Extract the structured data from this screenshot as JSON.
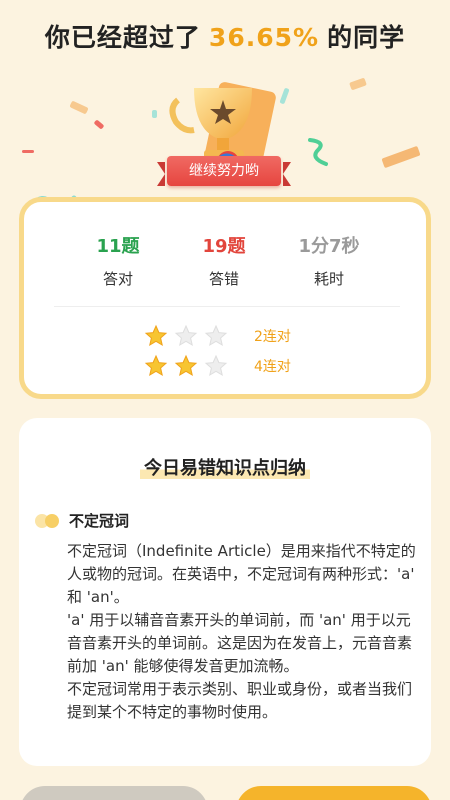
{
  "header": {
    "prefix": "你已经超过了",
    "percent": "36.65%",
    "suffix": "的同学"
  },
  "trophy": {
    "icon": "trophy-icon",
    "ribbon_text": "继续努力哟"
  },
  "stats": {
    "correct": {
      "value": "11题",
      "label": "答对",
      "color": "#2aa24f"
    },
    "wrong": {
      "value": "19题",
      "label": "答错",
      "color": "#e2453c"
    },
    "time": {
      "value": "1分7秒",
      "label": "耗时",
      "color": "#9a9a9a"
    }
  },
  "combos": [
    {
      "stars_filled": 1,
      "stars_total": 3,
      "label": "2连对"
    },
    {
      "stars_filled": 2,
      "stars_total": 3,
      "label": "4连对"
    }
  ],
  "knowledge": {
    "title": "今日易错知识点归纳",
    "subtitle": "不定冠词",
    "paragraphs": [
      "不定冠词（Indefinite Article）是用来指代不特定的人或物的冠词。在英语中，不定冠词有两种形式：'a' 和 'an'。",
      "'a' 用于以辅音音素开头的单词前，而 'an' 用于以元音音素开头的单词前。这是因为在发音上，元音音素前加 'an' 能够使得发音更加流畅。",
      "不定冠词常用于表示类别、职业或身份，或者当我们提到某个不特定的事物时使用。"
    ]
  },
  "colors": {
    "accent": "#f0a21a",
    "card_border": "#f8d98a",
    "background": "#fcf3e0"
  }
}
